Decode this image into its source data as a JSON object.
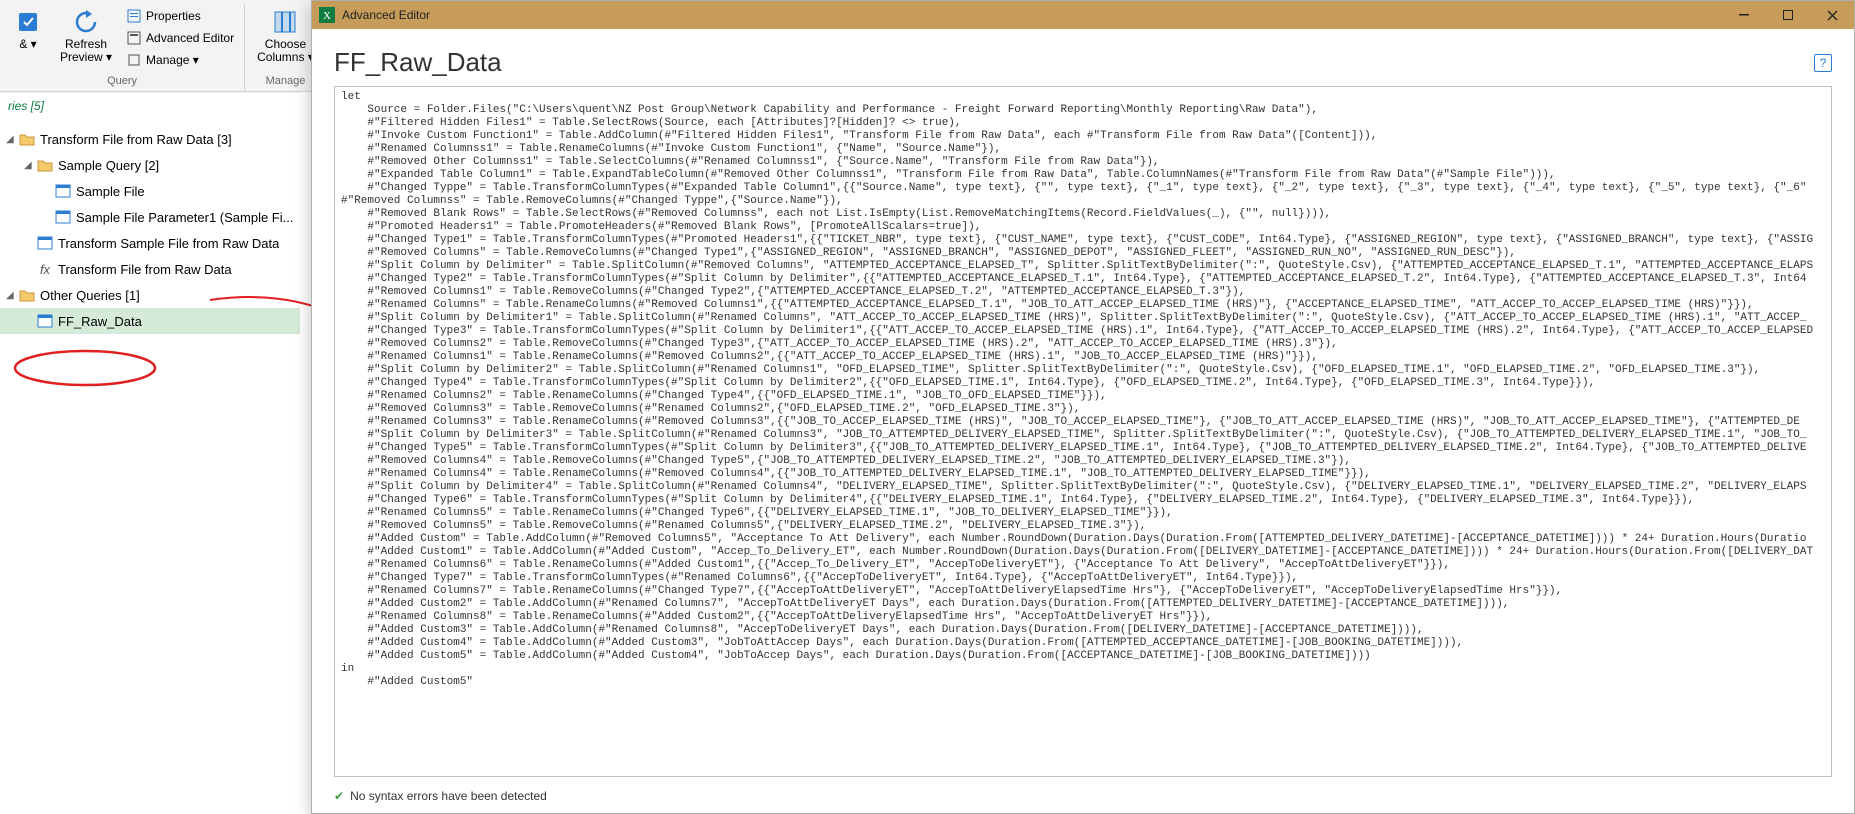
{
  "ribbon": {
    "apply_label": "& ▾",
    "refresh_label": "Refresh\nPreview ▾",
    "properties_label": "Properties",
    "adv_editor_label": "Advanced Editor",
    "manage_label": "Manage ▾",
    "group1_label": "Query",
    "choose_cols_label": "Choose\nColumns ▾",
    "group2_label": "Manage"
  },
  "queries": {
    "header": "ries [5]",
    "items": [
      {
        "label": "Transform File from Raw Data [3]",
        "icon": "folder",
        "indent": 0
      },
      {
        "label": "Sample Query [2]",
        "icon": "folder",
        "indent": 1
      },
      {
        "label": "Sample File",
        "icon": "sheet",
        "indent": 2
      },
      {
        "label": "Sample File Parameter1 (Sample Fi...",
        "icon": "sheet",
        "indent": 2
      },
      {
        "label": "Transform Sample File from Raw Data",
        "icon": "sheet",
        "indent": 1
      },
      {
        "label": "Transform File from Raw Data",
        "icon": "fx",
        "indent": 1
      },
      {
        "label": "Other Queries [1]",
        "icon": "folder",
        "indent": 0
      },
      {
        "label": "FF_Raw_Data",
        "icon": "sheet",
        "indent": 1,
        "selected": true
      }
    ]
  },
  "adv": {
    "title": "Advanced Editor",
    "heading": "FF_Raw_Data",
    "status": "No syntax errors have been detected",
    "code": "let\n    Source = Folder.Files(\"C:\\Users\\quent\\NZ Post Group\\Network Capability and Performance - Freight Forward Reporting\\Monthly Reporting\\Raw Data\"),\n    #\"Filtered Hidden Files1\" = Table.SelectRows(Source, each [Attributes]?[Hidden]? <> true),\n    #\"Invoke Custom Function1\" = Table.AddColumn(#\"Filtered Hidden Files1\", \"Transform File from Raw Data\", each #\"Transform File from Raw Data\"([Content])),\n    #\"Renamed Columnss1\" = Table.RenameColumns(#\"Invoke Custom Function1\", {\"Name\", \"Source.Name\"}),\n    #\"Removed Other Columnss1\" = Table.SelectColumns(#\"Renamed Columnss1\", {\"Source.Name\", \"Transform File from Raw Data\"}),\n    #\"Expanded Table Column1\" = Table.ExpandTableColumn(#\"Removed Other Columnss1\", \"Transform File from Raw Data\", Table.ColumnNames(#\"Transform File from Raw Data\"(#\"Sample File\"))),\n    #\"Changed Typpe\" = Table.TransformColumnTypes(#\"Expanded Table Column1\",{{\"Source.Name\", type text}, {\"\", type text}, {\"_1\", type text}, {\"_2\", type text}, {\"_3\", type text}, {\"_4\", type text}, {\"_5\", type text}, {\"_6\"\n#\"Removed Columnss\" = Table.RemoveColumns(#\"Changed Typpe\",{\"Source.Name\"}),\n    #\"Removed Blank Rows\" = Table.SelectRows(#\"Removed Columnss\", each not List.IsEmpty(List.RemoveMatchingItems(Record.FieldValues(_), {\"\", null}))),\n    #\"Promoted Headers1\" = Table.PromoteHeaders(#\"Removed Blank Rows\", [PromoteAllScalars=true]),\n    #\"Changed Type1\" = Table.TransformColumnTypes(#\"Promoted Headers1\",{{\"TICKET_NBR\", type text}, {\"CUST_NAME\", type text}, {\"CUST_CODE\", Int64.Type}, {\"ASSIGNED_REGION\", type text}, {\"ASSIGNED_BRANCH\", type text}, {\"ASSIG\n    #\"Removed Columns\" = Table.RemoveColumns(#\"Changed Type1\",{\"ASSIGNED_REGION\", \"ASSIGNED_BRANCH\", \"ASSIGNED_DEPOT\", \"ASSIGNED_FLEET\", \"ASSIGNED_RUN_NO\", \"ASSIGNED_RUN_DESC\"}),\n    #\"Split Column by Delimiter\" = Table.SplitColumn(#\"Removed Columns\", \"ATTEMPTED_ACCEPTANCE_ELAPSED_T\", Splitter.SplitTextByDelimiter(\":\", QuoteStyle.Csv), {\"ATTEMPTED_ACCEPTANCE_ELAPSED_T.1\", \"ATTEMPTED_ACCEPTANCE_ELAPS\n    #\"Changed Type2\" = Table.TransformColumnTypes(#\"Split Column by Delimiter\",{{\"ATTEMPTED_ACCEPTANCE_ELAPSED_T.1\", Int64.Type}, {\"ATTEMPTED_ACCEPTANCE_ELAPSED_T.2\", Int64.Type}, {\"ATTEMPTED_ACCEPTANCE_ELAPSED_T.3\", Int64\n    #\"Removed Columns1\" = Table.RemoveColumns(#\"Changed Type2\",{\"ATTEMPTED_ACCEPTANCE_ELAPSED_T.2\", \"ATTEMPTED_ACCEPTANCE_ELAPSED_T.3\"}),\n    #\"Renamed Columns\" = Table.RenameColumns(#\"Removed Columns1\",{{\"ATTEMPTED_ACCEPTANCE_ELAPSED_T.1\", \"JOB_TO_ATT_ACCEP_ELAPSED_TIME (HRS)\"}, {\"ACCEPTANCE_ELAPSED_TIME\", \"ATT_ACCEP_TO_ACCEP_ELAPSED_TIME (HRS)\"}}),\n    #\"Split Column by Delimiter1\" = Table.SplitColumn(#\"Renamed Columns\", \"ATT_ACCEP_TO_ACCEP_ELAPSED_TIME (HRS)\", Splitter.SplitTextByDelimiter(\":\", QuoteStyle.Csv), {\"ATT_ACCEP_TO_ACCEP_ELAPSED_TIME (HRS).1\", \"ATT_ACCEP_\n    #\"Changed Type3\" = Table.TransformColumnTypes(#\"Split Column by Delimiter1\",{{\"ATT_ACCEP_TO_ACCEP_ELAPSED_TIME (HRS).1\", Int64.Type}, {\"ATT_ACCEP_TO_ACCEP_ELAPSED_TIME (HRS).2\", Int64.Type}, {\"ATT_ACCEP_TO_ACCEP_ELAPSED\n    #\"Removed Columns2\" = Table.RemoveColumns(#\"Changed Type3\",{\"ATT_ACCEP_TO_ACCEP_ELAPSED_TIME (HRS).2\", \"ATT_ACCEP_TO_ACCEP_ELAPSED_TIME (HRS).3\"}),\n    #\"Renamed Columns1\" = Table.RenameColumns(#\"Removed Columns2\",{{\"ATT_ACCEP_TO_ACCEP_ELAPSED_TIME (HRS).1\", \"JOB_TO_ACCEP_ELAPSED_TIME (HRS)\"}}),\n    #\"Split Column by Delimiter2\" = Table.SplitColumn(#\"Renamed Columns1\", \"OFD_ELAPSED_TIME\", Splitter.SplitTextByDelimiter(\":\", QuoteStyle.Csv), {\"OFD_ELAPSED_TIME.1\", \"OFD_ELAPSED_TIME.2\", \"OFD_ELAPSED_TIME.3\"}),\n    #\"Changed Type4\" = Table.TransformColumnTypes(#\"Split Column by Delimiter2\",{{\"OFD_ELAPSED_TIME.1\", Int64.Type}, {\"OFD_ELAPSED_TIME.2\", Int64.Type}, {\"OFD_ELAPSED_TIME.3\", Int64.Type}}),\n    #\"Renamed Columns2\" = Table.RenameColumns(#\"Changed Type4\",{{\"OFD_ELAPSED_TIME.1\", \"JOB_TO_OFD_ELAPSED_TIME\"}}),\n    #\"Removed Columns3\" = Table.RemoveColumns(#\"Renamed Columns2\",{\"OFD_ELAPSED_TIME.2\", \"OFD_ELAPSED_TIME.3\"}),\n    #\"Renamed Columns3\" = Table.RenameColumns(#\"Removed Columns3\",{{\"JOB_TO_ACCEP_ELAPSED_TIME (HRS)\", \"JOB_TO_ACCEP_ELAPSED_TIME\"}, {\"JOB_TO_ATT_ACCEP_ELAPSED_TIME (HRS)\", \"JOB_TO_ATT_ACCEP_ELAPSED_TIME\"}, {\"ATTEMPTED_DE\n    #\"Split Column by Delimiter3\" = Table.SplitColumn(#\"Renamed Columns3\", \"JOB_TO_ATTEMPTED_DELIVERY_ELAPSED_TIME\", Splitter.SplitTextByDelimiter(\":\", QuoteStyle.Csv), {\"JOB_TO_ATTEMPTED_DELIVERY_ELAPSED_TIME.1\", \"JOB_TO_\n    #\"Changed Type5\" = Table.TransformColumnTypes(#\"Split Column by Delimiter3\",{{\"JOB_TO_ATTEMPTED_DELIVERY_ELAPSED_TIME.1\", Int64.Type}, {\"JOB_TO_ATTEMPTED_DELIVERY_ELAPSED_TIME.2\", Int64.Type}, {\"JOB_TO_ATTEMPTED_DELIVE\n    #\"Removed Columns4\" = Table.RemoveColumns(#\"Changed Type5\",{\"JOB_TO_ATTEMPTED_DELIVERY_ELAPSED_TIME.2\", \"JOB_TO_ATTEMPTED_DELIVERY_ELAPSED_TIME.3\"}),\n    #\"Renamed Columns4\" = Table.RenameColumns(#\"Removed Columns4\",{{\"JOB_TO_ATTEMPTED_DELIVERY_ELAPSED_TIME.1\", \"JOB_TO_ATTEMPTED_DELIVERY_ELAPSED_TIME\"}}),\n    #\"Split Column by Delimiter4\" = Table.SplitColumn(#\"Renamed Columns4\", \"DELIVERY_ELAPSED_TIME\", Splitter.SplitTextByDelimiter(\":\", QuoteStyle.Csv), {\"DELIVERY_ELAPSED_TIME.1\", \"DELIVERY_ELAPSED_TIME.2\", \"DELIVERY_ELAPS\n    #\"Changed Type6\" = Table.TransformColumnTypes(#\"Split Column by Delimiter4\",{{\"DELIVERY_ELAPSED_TIME.1\", Int64.Type}, {\"DELIVERY_ELAPSED_TIME.2\", Int64.Type}, {\"DELIVERY_ELAPSED_TIME.3\", Int64.Type}}),\n    #\"Renamed Columns5\" = Table.RenameColumns(#\"Changed Type6\",{{\"DELIVERY_ELAPSED_TIME.1\", \"JOB_TO_DELIVERY_ELAPSED_TIME\"}}),\n    #\"Removed Columns5\" = Table.RemoveColumns(#\"Renamed Columns5\",{\"DELIVERY_ELAPSED_TIME.2\", \"DELIVERY_ELAPSED_TIME.3\"}),\n    #\"Added Custom\" = Table.AddColumn(#\"Removed Columns5\", \"Acceptance To Att Delivery\", each Number.RoundDown(Duration.Days(Duration.From([ATTEMPTED_DELIVERY_DATETIME]-[ACCEPTANCE_DATETIME]))) * 24+ Duration.Hours(Duratio\n    #\"Added Custom1\" = Table.AddColumn(#\"Added Custom\", \"Accep_To_Delivery_ET\", each Number.RoundDown(Duration.Days(Duration.From([DELIVERY_DATETIME]-[ACCEPTANCE_DATETIME]))) * 24+ Duration.Hours(Duration.From([DELIVERY_DAT\n    #\"Renamed Columns6\" = Table.RenameColumns(#\"Added Custom1\",{{\"Accep_To_Delivery_ET\", \"AccepToDeliveryET\"}, {\"Acceptance To Att Delivery\", \"AccepToAttDeliveryET\"}}),\n    #\"Changed Type7\" = Table.TransformColumnTypes(#\"Renamed Columns6\",{{\"AccepToDeliveryET\", Int64.Type}, {\"AccepToAttDeliveryET\", Int64.Type}}),\n    #\"Renamed Columns7\" = Table.RenameColumns(#\"Changed Type7\",{{\"AccepToAttDeliveryET\", \"AccepToAttDeliveryElapsedTime Hrs\"}, {\"AccepToDeliveryET\", \"AccepToDeliveryElapsedTime Hrs\"}}),\n    #\"Added Custom2\" = Table.AddColumn(#\"Renamed Columns7\", \"AccepToAttDeliveryET Days\", each Duration.Days(Duration.From([ATTEMPTED_DELIVERY_DATETIME]-[ACCEPTANCE_DATETIME]))),\n    #\"Renamed Columns8\" = Table.RenameColumns(#\"Added Custom2\",{{\"AccepToAttDeliveryElapsedTime Hrs\", \"AccepToAttDeliveryET Hrs\"}}),\n    #\"Added Custom3\" = Table.AddColumn(#\"Renamed Columns8\", \"AccepToDeliveryET Days\", each Duration.Days(Duration.From([DELIVERY_DATETIME]-[ACCEPTANCE_DATETIME]))),\n    #\"Added Custom4\" = Table.AddColumn(#\"Added Custom3\", \"JobToAttAccep Days\", each Duration.Days(Duration.From([ATTEMPTED_ACCEPTANCE_DATETIME]-[JOB_BOOKING_DATETIME]))),\n    #\"Added Custom5\" = Table.AddColumn(#\"Added Custom4\", \"JobToAccep Days\", each Duration.Days(Duration.From([ACCEPTANCE_DATETIME]-[JOB_BOOKING_DATETIME])))\nin\n    #\"Added Custom5\""
  }
}
